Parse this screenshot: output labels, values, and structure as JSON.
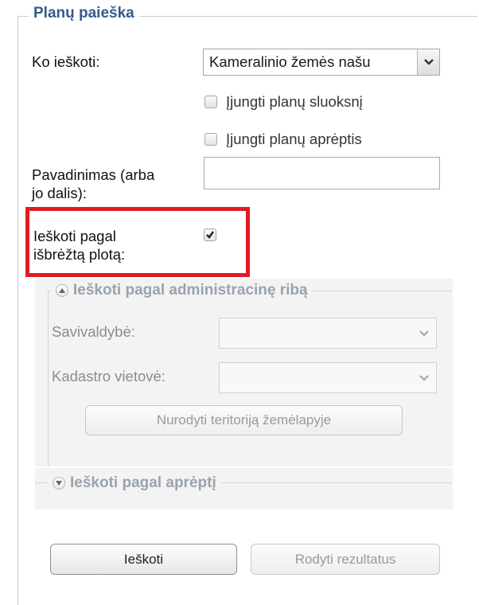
{
  "search_panel": {
    "legend": "Planų paieška",
    "what_label": "Ko ieškoti:",
    "what_value": "Kameralinio žemės našu",
    "layer_checkbox_label": "Įjungti planų sluoksnį",
    "coverage_checkbox_label": "Įjungti planų aprėptis",
    "name_label_line1": "Pavadinimas (arba",
    "name_label_line2": "jo dalis):",
    "name_value": "",
    "area_label_line1": "Ieškoti pagal",
    "area_label_line2": "išbrėžtą plotą:",
    "area_checked": true
  },
  "admin_section": {
    "legend": "Ieškoti pagal administracinę ribą",
    "municipality_label": "Savivaldybė:",
    "municipality_value": "",
    "cadastre_label": "Kadastro vietovė:",
    "cadastre_value": "",
    "territory_button": "Nurodyti teritoriją žemėlapyje"
  },
  "coverage_section": {
    "legend": "Ieškoti pagal aprėptį"
  },
  "actions": {
    "search_button": "Ieškoti",
    "results_button": "Rodyti rezultatus"
  },
  "colors": {
    "legend_blue": "#335b8c",
    "highlight_red": "#e11b24",
    "disabled_text": "#9aa3ad"
  }
}
